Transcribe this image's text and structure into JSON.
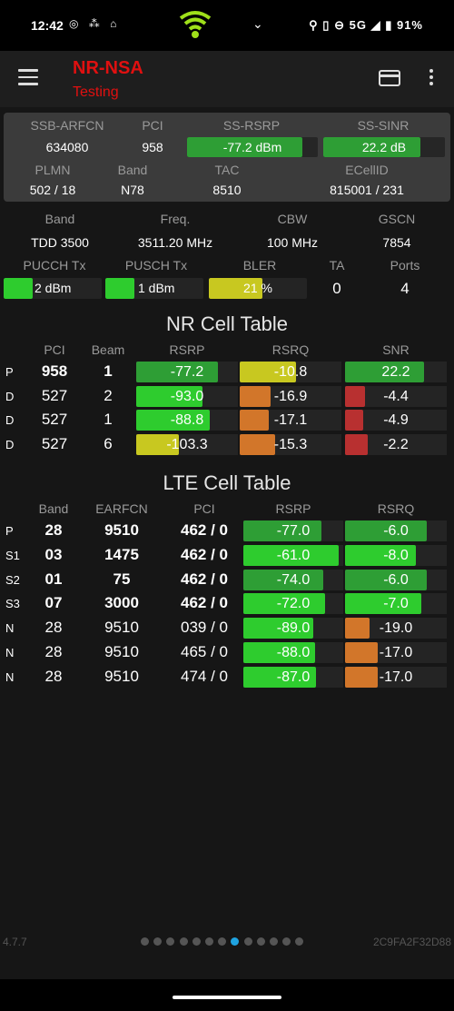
{
  "status_bar": {
    "time": "12:42",
    "left_icons": [
      "ring-icon",
      "signal-icon",
      "vpn-icon"
    ],
    "network": "5G",
    "battery": "91%",
    "right_icons": [
      "location-icon",
      "vibrate-icon",
      "dnd-icon",
      "signal-icon",
      "battery-icon"
    ]
  },
  "app_bar": {
    "title": "NR-NSA",
    "subtitle": "Testing",
    "title_color": "#e01010"
  },
  "summary": {
    "headers": [
      "SSB-ARFCN",
      "PCI",
      "SS-RSRP",
      "SS-SINR"
    ],
    "ssb_arfcn": "634080",
    "pci": "958",
    "ss_rsrp": {
      "text": "-77.2 dBm",
      "fill": 0.88
    },
    "ss_sinr": {
      "text": "22.2 dB",
      "fill": 0.8
    },
    "headers2": [
      "PLMN",
      "Band",
      "TAC",
      "ECellID"
    ],
    "plmn": "502 / 18",
    "band": "N78",
    "tac": "8510",
    "ecellid": "815001 / 231"
  },
  "info": {
    "headers": [
      "Band",
      "Freq.",
      "CBW",
      "GSCN"
    ],
    "band": "TDD 3500",
    "freq": "3511.20 MHz",
    "cbw": "100 MHz",
    "gscn": "7854",
    "headers2": [
      "PUCCH Tx",
      "PUSCH Tx",
      "BLER",
      "TA",
      "Ports"
    ],
    "pucch_tx": {
      "text": "2 dBm",
      "fill": 0.3
    },
    "pusch_tx": {
      "text": "1 dBm",
      "fill": 0.3
    },
    "bler": {
      "text": "21 %",
      "fill": 0.55
    },
    "ta": "0",
    "ports": "4"
  },
  "nr_table": {
    "title": "NR Cell Table",
    "headers": [
      "PCI",
      "Beam",
      "RSRP",
      "RSRQ",
      "SNR"
    ],
    "rows": [
      {
        "type": "P",
        "pci": "958",
        "beam": "1",
        "rsrp": "-77.2",
        "rsrp_fill": 0.8,
        "rsrp_color": "#2e9e35",
        "rsrq": "-10.8",
        "rsrq_fill": 0.55,
        "rsrq_color": "#c8c820",
        "snr": "22.2",
        "snr_fill": 0.78,
        "snr_color": "#2e9e35"
      },
      {
        "type": "D",
        "pci": "527",
        "beam": "2",
        "rsrp": "-93.0",
        "rsrp_fill": 0.65,
        "rsrp_color": "#2ecc2e",
        "rsrq": "-16.9",
        "rsrq_fill": 0.3,
        "rsrq_color": "#d2762a",
        "snr": "-4.4",
        "snr_fill": 0.2,
        "snr_color": "#b83030"
      },
      {
        "type": "D",
        "pci": "527",
        "beam": "1",
        "rsrp": "-88.8",
        "rsrp_fill": 0.72,
        "rsrp_color": "#2ecc2e",
        "rsrq": "-17.1",
        "rsrq_fill": 0.29,
        "rsrq_color": "#d2762a",
        "snr": "-4.9",
        "snr_fill": 0.18,
        "snr_color": "#b83030"
      },
      {
        "type": "D",
        "pci": "527",
        "beam": "6",
        "rsrp": "-103.3",
        "rsrp_fill": 0.42,
        "rsrp_color": "#c8c820",
        "rsrq": "-15.3",
        "rsrq_fill": 0.35,
        "rsrq_color": "#d2762a",
        "snr": "-2.2",
        "snr_fill": 0.22,
        "snr_color": "#b83030"
      }
    ]
  },
  "lte_table": {
    "title": "LTE Cell Table",
    "headers": [
      "Band",
      "EARFCN",
      "PCI",
      "RSRP",
      "RSRQ"
    ],
    "rows": [
      {
        "type": "P",
        "band": "28",
        "earfcn": "9510",
        "pci": "462 / 0",
        "rsrp": "-77.0",
        "rsrp_fill": 0.78,
        "rsrp_color": "#2e9e35",
        "rsrq": "-6.0",
        "rsrq_fill": 0.8,
        "rsrq_color": "#2e9e35"
      },
      {
        "type": "S1",
        "band": "03",
        "earfcn": "1475",
        "pci": "462 / 0",
        "rsrp": "-61.0",
        "rsrp_fill": 0.95,
        "rsrp_color": "#2ecc2e",
        "rsrq": "-8.0",
        "rsrq_fill": 0.7,
        "rsrq_color": "#2ecc2e"
      },
      {
        "type": "S2",
        "band": "01",
        "earfcn": "75",
        "pci": "462 / 0",
        "rsrp": "-74.0",
        "rsrp_fill": 0.8,
        "rsrp_color": "#2e9e35",
        "rsrq": "-6.0",
        "rsrq_fill": 0.8,
        "rsrq_color": "#2e9e35"
      },
      {
        "type": "S3",
        "band": "07",
        "earfcn": "3000",
        "pci": "462 / 0",
        "rsrp": "-72.0",
        "rsrp_fill": 0.82,
        "rsrp_color": "#2ecc2e",
        "rsrq": "-7.0",
        "rsrq_fill": 0.75,
        "rsrq_color": "#2ecc2e"
      },
      {
        "type": "N",
        "band": "28",
        "earfcn": "9510",
        "pci": "039 / 0",
        "rsrp": "-89.0",
        "rsrp_fill": 0.7,
        "rsrp_color": "#2ecc2e",
        "rsrq": "-19.0",
        "rsrq_fill": 0.24,
        "rsrq_color": "#d2762a"
      },
      {
        "type": "N",
        "band": "28",
        "earfcn": "9510",
        "pci": "465 / 0",
        "rsrp": "-88.0",
        "rsrp_fill": 0.72,
        "rsrp_color": "#2ecc2e",
        "rsrq": "-17.0",
        "rsrq_fill": 0.32,
        "rsrq_color": "#d2762a"
      },
      {
        "type": "N",
        "band": "28",
        "earfcn": "9510",
        "pci": "474 / 0",
        "rsrp": "-87.0",
        "rsrp_fill": 0.73,
        "rsrp_color": "#2ecc2e",
        "rsrq": "-17.0",
        "rsrq_fill": 0.32,
        "rsrq_color": "#d2762a"
      }
    ]
  },
  "footer": {
    "version": "4.7.7",
    "device_id": "2C9FA2F32D88",
    "page_count": 13,
    "active_page": 7,
    "active_color": "#1fa3e0"
  }
}
